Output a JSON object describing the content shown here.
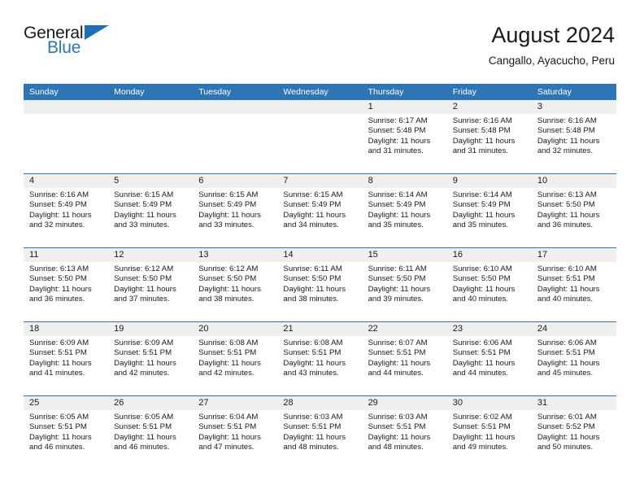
{
  "brand": {
    "name_part1": "General",
    "name_part2": "Blue",
    "logo_icon": "triangle-logo-icon"
  },
  "header": {
    "month_title": "August 2024",
    "location": "Cangallo, Ayacucho, Peru"
  },
  "theme": {
    "header_blue": "#2E75B6",
    "band_gray": "#efefef",
    "text": "#1a1a1a"
  },
  "weekdays": [
    "Sunday",
    "Monday",
    "Tuesday",
    "Wednesday",
    "Thursday",
    "Friday",
    "Saturday"
  ],
  "labels": {
    "sunrise_prefix": "Sunrise:",
    "sunset_prefix": "Sunset:",
    "daylight_prefix": "Daylight:"
  },
  "weeks": [
    [
      {
        "day": "",
        "empty": true
      },
      {
        "day": "",
        "empty": true
      },
      {
        "day": "",
        "empty": true
      },
      {
        "day": "",
        "empty": true
      },
      {
        "day": "1",
        "sunrise": "Sunrise: 6:17 AM",
        "sunset": "Sunset: 5:48 PM",
        "daylight": "Daylight: 11 hours and 31 minutes."
      },
      {
        "day": "2",
        "sunrise": "Sunrise: 6:16 AM",
        "sunset": "Sunset: 5:48 PM",
        "daylight": "Daylight: 11 hours and 31 minutes."
      },
      {
        "day": "3",
        "sunrise": "Sunrise: 6:16 AM",
        "sunset": "Sunset: 5:48 PM",
        "daylight": "Daylight: 11 hours and 32 minutes."
      }
    ],
    [
      {
        "day": "4",
        "sunrise": "Sunrise: 6:16 AM",
        "sunset": "Sunset: 5:49 PM",
        "daylight": "Daylight: 11 hours and 32 minutes."
      },
      {
        "day": "5",
        "sunrise": "Sunrise: 6:15 AM",
        "sunset": "Sunset: 5:49 PM",
        "daylight": "Daylight: 11 hours and 33 minutes."
      },
      {
        "day": "6",
        "sunrise": "Sunrise: 6:15 AM",
        "sunset": "Sunset: 5:49 PM",
        "daylight": "Daylight: 11 hours and 33 minutes."
      },
      {
        "day": "7",
        "sunrise": "Sunrise: 6:15 AM",
        "sunset": "Sunset: 5:49 PM",
        "daylight": "Daylight: 11 hours and 34 minutes."
      },
      {
        "day": "8",
        "sunrise": "Sunrise: 6:14 AM",
        "sunset": "Sunset: 5:49 PM",
        "daylight": "Daylight: 11 hours and 35 minutes."
      },
      {
        "day": "9",
        "sunrise": "Sunrise: 6:14 AM",
        "sunset": "Sunset: 5:49 PM",
        "daylight": "Daylight: 11 hours and 35 minutes."
      },
      {
        "day": "10",
        "sunrise": "Sunrise: 6:13 AM",
        "sunset": "Sunset: 5:50 PM",
        "daylight": "Daylight: 11 hours and 36 minutes."
      }
    ],
    [
      {
        "day": "11",
        "sunrise": "Sunrise: 6:13 AM",
        "sunset": "Sunset: 5:50 PM",
        "daylight": "Daylight: 11 hours and 36 minutes."
      },
      {
        "day": "12",
        "sunrise": "Sunrise: 6:12 AM",
        "sunset": "Sunset: 5:50 PM",
        "daylight": "Daylight: 11 hours and 37 minutes."
      },
      {
        "day": "13",
        "sunrise": "Sunrise: 6:12 AM",
        "sunset": "Sunset: 5:50 PM",
        "daylight": "Daylight: 11 hours and 38 minutes."
      },
      {
        "day": "14",
        "sunrise": "Sunrise: 6:11 AM",
        "sunset": "Sunset: 5:50 PM",
        "daylight": "Daylight: 11 hours and 38 minutes."
      },
      {
        "day": "15",
        "sunrise": "Sunrise: 6:11 AM",
        "sunset": "Sunset: 5:50 PM",
        "daylight": "Daylight: 11 hours and 39 minutes."
      },
      {
        "day": "16",
        "sunrise": "Sunrise: 6:10 AM",
        "sunset": "Sunset: 5:50 PM",
        "daylight": "Daylight: 11 hours and 40 minutes."
      },
      {
        "day": "17",
        "sunrise": "Sunrise: 6:10 AM",
        "sunset": "Sunset: 5:51 PM",
        "daylight": "Daylight: 11 hours and 40 minutes."
      }
    ],
    [
      {
        "day": "18",
        "sunrise": "Sunrise: 6:09 AM",
        "sunset": "Sunset: 5:51 PM",
        "daylight": "Daylight: 11 hours and 41 minutes."
      },
      {
        "day": "19",
        "sunrise": "Sunrise: 6:09 AM",
        "sunset": "Sunset: 5:51 PM",
        "daylight": "Daylight: 11 hours and 42 minutes."
      },
      {
        "day": "20",
        "sunrise": "Sunrise: 6:08 AM",
        "sunset": "Sunset: 5:51 PM",
        "daylight": "Daylight: 11 hours and 42 minutes."
      },
      {
        "day": "21",
        "sunrise": "Sunrise: 6:08 AM",
        "sunset": "Sunset: 5:51 PM",
        "daylight": "Daylight: 11 hours and 43 minutes."
      },
      {
        "day": "22",
        "sunrise": "Sunrise: 6:07 AM",
        "sunset": "Sunset: 5:51 PM",
        "daylight": "Daylight: 11 hours and 44 minutes."
      },
      {
        "day": "23",
        "sunrise": "Sunrise: 6:06 AM",
        "sunset": "Sunset: 5:51 PM",
        "daylight": "Daylight: 11 hours and 44 minutes."
      },
      {
        "day": "24",
        "sunrise": "Sunrise: 6:06 AM",
        "sunset": "Sunset: 5:51 PM",
        "daylight": "Daylight: 11 hours and 45 minutes."
      }
    ],
    [
      {
        "day": "25",
        "sunrise": "Sunrise: 6:05 AM",
        "sunset": "Sunset: 5:51 PM",
        "daylight": "Daylight: 11 hours and 46 minutes."
      },
      {
        "day": "26",
        "sunrise": "Sunrise: 6:05 AM",
        "sunset": "Sunset: 5:51 PM",
        "daylight": "Daylight: 11 hours and 46 minutes."
      },
      {
        "day": "27",
        "sunrise": "Sunrise: 6:04 AM",
        "sunset": "Sunset: 5:51 PM",
        "daylight": "Daylight: 11 hours and 47 minutes."
      },
      {
        "day": "28",
        "sunrise": "Sunrise: 6:03 AM",
        "sunset": "Sunset: 5:51 PM",
        "daylight": "Daylight: 11 hours and 48 minutes."
      },
      {
        "day": "29",
        "sunrise": "Sunrise: 6:03 AM",
        "sunset": "Sunset: 5:51 PM",
        "daylight": "Daylight: 11 hours and 48 minutes."
      },
      {
        "day": "30",
        "sunrise": "Sunrise: 6:02 AM",
        "sunset": "Sunset: 5:51 PM",
        "daylight": "Daylight: 11 hours and 49 minutes."
      },
      {
        "day": "31",
        "sunrise": "Sunrise: 6:01 AM",
        "sunset": "Sunset: 5:52 PM",
        "daylight": "Daylight: 11 hours and 50 minutes."
      }
    ]
  ]
}
